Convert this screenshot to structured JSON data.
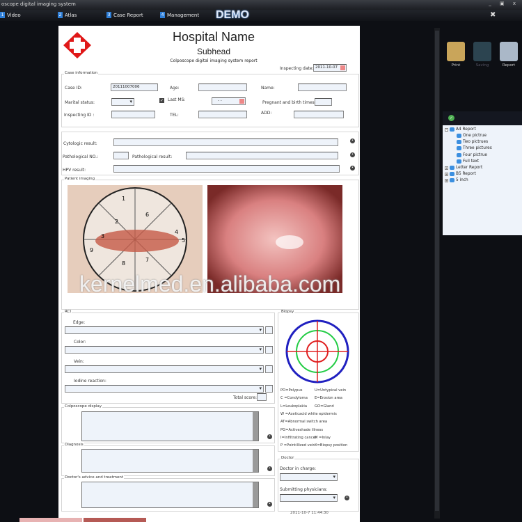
{
  "window": {
    "title": "oscope digital imaging system",
    "controls": "_ ▣ x"
  },
  "menu": [
    {
      "num": "1",
      "label": "Video"
    },
    {
      "num": "2",
      "label": "Atlas"
    },
    {
      "num": "3",
      "label": "Case Report"
    },
    {
      "num": "4",
      "label": "Management"
    }
  ],
  "demo": "DEMO",
  "header": {
    "hospital": "Hospital Name",
    "subhead": "Subhead",
    "report_title": "Colposcope digital imaging system report",
    "inspecting_date_label": "Inspecting date:",
    "inspecting_date": "2011-10-07"
  },
  "case": {
    "group": "Case information",
    "case_id_label": "Case ID:",
    "case_id": "20111007006",
    "age_label": "Age:",
    "name_label": "Name:",
    "marital_label": "Marital status:",
    "last_ms_label": "Last MS:",
    "last_ms_value": "- -",
    "pregnant_label": "Pregnant and birth times:",
    "inspecting_id_label": "Inspecting ID :",
    "tel_label": "TEL:",
    "add_label": "ADD:"
  },
  "results": {
    "cytologic": "Cytologic result:",
    "path_no": "Pathological NO.:",
    "path_result": "Pathological result:",
    "hpv": "HPV result:"
  },
  "imaging": {
    "group": "Patient imaging",
    "diagram_numbers": [
      "1",
      "2",
      "3",
      "4",
      "5",
      "6",
      "7",
      "8",
      "9"
    ]
  },
  "watermark": "kernelmed.en.alibaba.com",
  "rci": {
    "group": "RCI",
    "edge": "Edge:",
    "color": "Color:",
    "vein": "Vein:",
    "iodine": "Iodine reaction:",
    "total": "Total score:"
  },
  "biopsy": {
    "group": "Biopsy",
    "legend": [
      [
        "PO=Polypus",
        "U=Untypical vein"
      ],
      [
        "C =Condyloma",
        "E=Erosion area"
      ],
      [
        "L=Leukoplakia",
        "GO=Gland"
      ],
      [
        "W =Aceticacid white epidermis",
        ""
      ],
      [
        "AT=Abnormal switch area",
        ""
      ],
      [
        "PG=Activeshade illness",
        ""
      ],
      [
        "I=Infiltrating cancer",
        "M =Inlay"
      ],
      [
        "P =Pointillized vein",
        "X=Biopsy position"
      ]
    ],
    "colors": {
      "outer": "#2020c0",
      "middle": "#22cc44",
      "inner": "#e02020"
    }
  },
  "colposcope": {
    "group": "Colposcope display"
  },
  "diagnosis": {
    "group": "Diagnosis"
  },
  "advice": {
    "group": "Doctor's advice and treatment"
  },
  "doctor": {
    "group": "Doctor",
    "in_charge": "Doctor in charge:",
    "submitting": "Submitting physicians:"
  },
  "timestamp": "2011-10-7 11:44:30",
  "toolbar": {
    "print": "Print",
    "saving": "Saving",
    "report": "Report"
  },
  "tree": {
    "root": "A4 Report",
    "children": [
      "One pictrue",
      "Two pictrues",
      "Three pictures",
      "Four pictrue",
      "Full text"
    ],
    "others": [
      "Letter Report",
      "B5 Report",
      "5 inch"
    ]
  }
}
